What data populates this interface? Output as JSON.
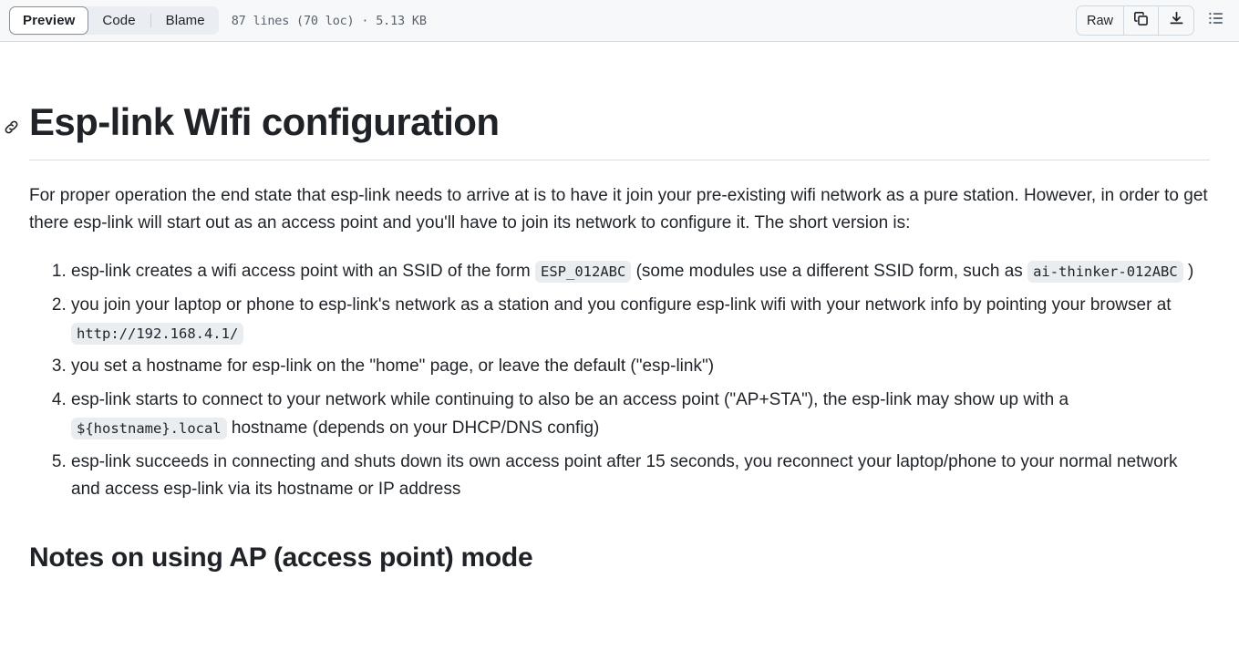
{
  "header": {
    "tabs": [
      {
        "label": "Preview",
        "selected": true
      },
      {
        "label": "Code",
        "selected": false
      },
      {
        "label": "Blame",
        "selected": false
      }
    ],
    "file_meta": "87 lines (70 loc) · 5.13 KB",
    "raw_label": "Raw",
    "copy_icon": "copy-icon",
    "download_icon": "download-icon",
    "toc_icon": "table-of-contents-icon",
    "background": "#f6f8fa",
    "border": "#d1d9e0",
    "segment_bg": "#eaeef2"
  },
  "document": {
    "h1": "Esp-link Wifi configuration",
    "anchor_icon": "link-icon",
    "intro": "For proper operation the end state that esp-link needs to arrive at is to have it join your pre-existing wifi network as a pure station. However, in order to get there esp-link will start out as an access point and you'll have to join its network to configure it. The short version is:",
    "steps": [
      {
        "part1": "esp-link creates a wifi access point with an SSID of the form ",
        "code1": "ESP_012ABC",
        "part2": " (some modules use a different SSID form, such as ",
        "code2": "ai-thinker-012ABC",
        "part3": " )"
      },
      {
        "part1": "you join your laptop or phone to esp-link's network as a station and you configure esp-link wifi with your network info by pointing your browser at ",
        "code1": "http://192.168.4.1/",
        "part2": "",
        "code2": "",
        "part3": ""
      },
      {
        "part1": "you set a hostname for esp-link on the \"home\" page, or leave the default (\"esp-link\")",
        "code1": "",
        "part2": "",
        "code2": "",
        "part3": ""
      },
      {
        "part1": "esp-link starts to connect to your network while continuing to also be an access point (\"AP+STA\"), the esp-link may show up with a ",
        "code1": "${hostname}.local",
        "part2": " hostname (depends on your DHCP/DNS config)",
        "code2": "",
        "part3": ""
      },
      {
        "part1": "esp-link succeeds in connecting and shuts down its own access point after 15 seconds, you reconnect your laptop/phone to your normal network and access esp-link via its hostname or IP address",
        "code1": "",
        "part2": "",
        "code2": "",
        "part3": ""
      }
    ],
    "h2": "Notes on using AP (access point) mode",
    "code_bg": "#eaedf0",
    "text_color": "#1f2328"
  }
}
